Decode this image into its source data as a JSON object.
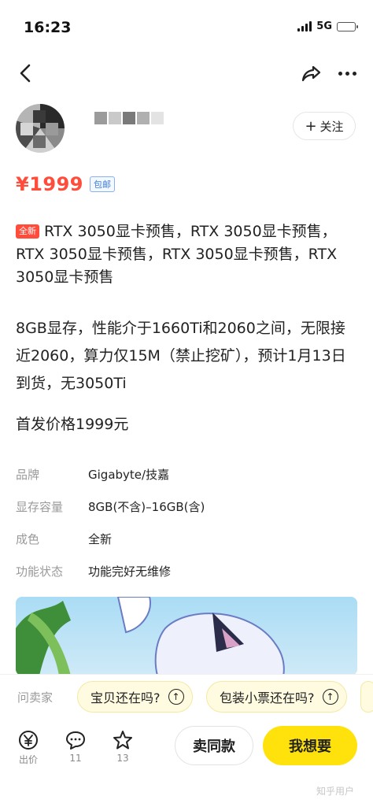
{
  "status_bar": {
    "time": "16:23",
    "network": "5G"
  },
  "nav": {
    "back_icon": "chevron-left-icon",
    "share_icon": "share-icon",
    "more_icon": "more-icon"
  },
  "seller": {
    "follow_label": "关注"
  },
  "price": {
    "value": "¥1999",
    "free_shipping": "包邮"
  },
  "description": {
    "tag": "全新",
    "title": "RTX 3050显卡预售，RTX 3050显卡预售，RTX 3050显卡预售，RTX 3050显卡预售，RTX 3050显卡预售",
    "body": "8GB显存，性能介于1660Ti和2060之间，无限接近2060，算力仅15M（禁止挖矿），预计1月13日到货，无3050Ti",
    "launch": "首发价格1999元"
  },
  "attributes": [
    {
      "key": "品牌",
      "value": "Gigabyte/技嘉"
    },
    {
      "key": "显存容量",
      "value": "8GB(不含)–16GB(含)"
    },
    {
      "key": "成色",
      "value": "全新"
    },
    {
      "key": "功能状态",
      "value": "功能完好无维修"
    }
  ],
  "ask_bar": {
    "label": "问卖家",
    "chips": [
      "宝贝还在吗?",
      "包装小票还在吗?"
    ]
  },
  "bottom_bar": {
    "bid": {
      "label": "出价"
    },
    "comments": {
      "count": "11"
    },
    "favorites": {
      "count": "13"
    },
    "same_label": "卖同款",
    "want_label": "我想要",
    "watermark": "知乎用户"
  },
  "colors": {
    "price": "#ff4c3b",
    "want_button": "#ffe20b",
    "chip_bg": "#fffbe0"
  }
}
